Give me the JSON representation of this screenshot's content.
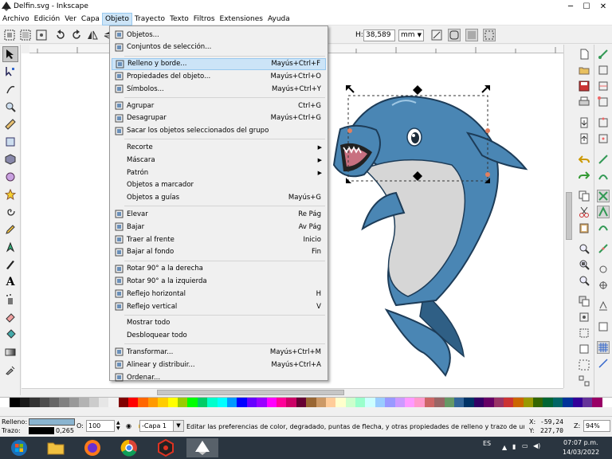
{
  "window": {
    "title": "Delfin.svg - Inkscape",
    "controls": [
      "─",
      "☐",
      "✕"
    ]
  },
  "menubar": [
    "Archivo",
    "Edición",
    "Ver",
    "Capa",
    "Objeto",
    "Trayecto",
    "Texto",
    "Filtros",
    "Extensiones",
    "Ayuda"
  ],
  "toolcontrols": {
    "h_label": "H:",
    "h_value": "38,589",
    "unit": "mm"
  },
  "objeto_menu": [
    {
      "label": "Objetos...",
      "shortcut": "",
      "icon": "objects-icon"
    },
    {
      "label": "Conjuntos de selección...",
      "shortcut": "",
      "icon": "selection-sets-icon"
    },
    {
      "sep": true
    },
    {
      "label": "Relleno y borde...",
      "shortcut": "Mayús+Ctrl+F",
      "icon": "fill-stroke-icon",
      "highlighted": true
    },
    {
      "label": "Propiedades del objeto...",
      "shortcut": "Mayús+Ctrl+O",
      "icon": "object-properties-icon"
    },
    {
      "label": "Símbolos...",
      "shortcut": "Mayús+Ctrl+Y",
      "icon": "symbols-icon"
    },
    {
      "sep": true
    },
    {
      "label": "Agrupar",
      "shortcut": "Ctrl+G",
      "icon": "group-icon"
    },
    {
      "label": "Desagrupar",
      "shortcut": "Mayús+Ctrl+G",
      "icon": "ungroup-icon"
    },
    {
      "label": "Sacar los objetos seleccionados del grupo",
      "shortcut": "",
      "icon": "pop-from-group-icon"
    },
    {
      "sep": true
    },
    {
      "label": "Recorte",
      "shortcut": "",
      "submenu": true
    },
    {
      "label": "Máscara",
      "shortcut": "",
      "submenu": true
    },
    {
      "label": "Patrón",
      "shortcut": "",
      "submenu": true
    },
    {
      "label": "Objetos a marcador",
      "shortcut": ""
    },
    {
      "label": "Objetos a guías",
      "shortcut": "Mayús+G"
    },
    {
      "sep": true
    },
    {
      "label": "Elevar",
      "shortcut": "Re Pág",
      "icon": "raise-icon"
    },
    {
      "label": "Bajar",
      "shortcut": "Av Pág",
      "icon": "lower-icon"
    },
    {
      "label": "Traer al frente",
      "shortcut": "Inicio",
      "icon": "raise-to-top-icon"
    },
    {
      "label": "Bajar al fondo",
      "shortcut": "Fin",
      "icon": "lower-to-bottom-icon"
    },
    {
      "sep": true
    },
    {
      "label": "Rotar 90° a la derecha",
      "shortcut": "",
      "icon": "rotate-cw-icon"
    },
    {
      "label": "Rotar 90° a la izquierda",
      "shortcut": "",
      "icon": "rotate-ccw-icon"
    },
    {
      "label": "Reflejo horizontal",
      "shortcut": "H",
      "icon": "flip-horizontal-icon"
    },
    {
      "label": "Reflejo vertical",
      "shortcut": "V",
      "icon": "flip-vertical-icon"
    },
    {
      "sep": true
    },
    {
      "label": "Mostrar todo",
      "shortcut": ""
    },
    {
      "label": "Desbloquear todo",
      "shortcut": ""
    },
    {
      "sep": true
    },
    {
      "label": "Transformar...",
      "shortcut": "Mayús+Ctrl+M",
      "icon": "transform-icon"
    },
    {
      "label": "Alinear y distribuir...",
      "shortcut": "Mayús+Ctrl+A",
      "icon": "align-icon"
    },
    {
      "label": "Ordenar...",
      "shortcut": "",
      "icon": "arrange-icon"
    }
  ],
  "statusbar": {
    "fill_label": "Relleno:",
    "stroke_label": "Trazo:",
    "stroke_width": "0,265",
    "opacity_label": "O:",
    "opacity_value": "100",
    "layer": "-Capa 1",
    "message": "Editar las preferencias de color, degradado, puntas de flecha, y otras propiedades de relleno y trazo de un o...",
    "x_label": "X:",
    "x_value": "-59,24",
    "y_label": "Y:",
    "y_value": "227,70",
    "zoom_label": "Z:",
    "zoom_value": "94%",
    "rotation_label": "R:"
  },
  "taskbar": {
    "lang": "ES",
    "time": "07:07 p.m.",
    "date": "14/03/2022"
  },
  "colors": {
    "fill_swatch": "#8ab4d0",
    "dolphin_body": "#4a86b4",
    "dolphin_dark": "#2f5f85",
    "dolphin_belly": "#d6d6d6",
    "menu_highlight": "#cce4f7"
  }
}
